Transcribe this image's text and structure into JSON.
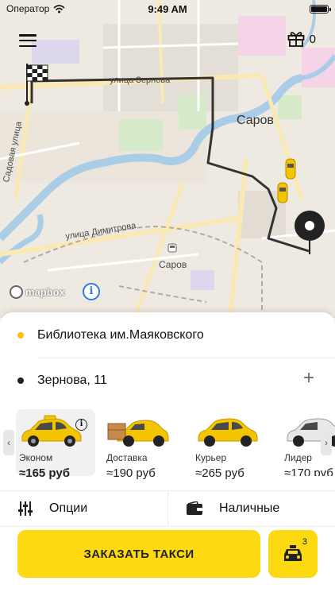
{
  "status_bar": {
    "carrier": "Оператор",
    "time": "9:49 AM"
  },
  "map": {
    "streets": {
      "zernova": "улица Зернова",
      "sadovaya": "Садовая улица",
      "dimitrova": "улица Димитрова"
    },
    "city": "Саров",
    "station": "Саров",
    "attribution": "mapbox",
    "info_glyph": "i"
  },
  "header": {
    "gift_count": "0"
  },
  "route": {
    "from": {
      "label": "Библиотека им.Маяковского",
      "dot_color": "#f5c400"
    },
    "to": {
      "label": "Зернова, 11",
      "dot_color": "#222222"
    },
    "add_glyph": "+"
  },
  "tariffs": [
    {
      "name": "Эконом",
      "price": "≈165 руб",
      "selected": true,
      "info": "i"
    },
    {
      "name": "Доставка",
      "price": "≈190 руб"
    },
    {
      "name": "Курьер",
      "price": "≈265 руб"
    },
    {
      "name": "Лидер",
      "price": "≈170 руб"
    }
  ],
  "carousel": {
    "prev": "‹",
    "next": "›"
  },
  "options": {
    "options_label": "Опции",
    "payment_label": "Наличные"
  },
  "actions": {
    "order_label": "ЗАКАЗАТЬ ТАКСИ",
    "fleet_count": "3"
  },
  "colors": {
    "accent": "#fcd910",
    "route_line": "#333333",
    "map_bg": "#efeae1",
    "river": "#a9cde6"
  }
}
